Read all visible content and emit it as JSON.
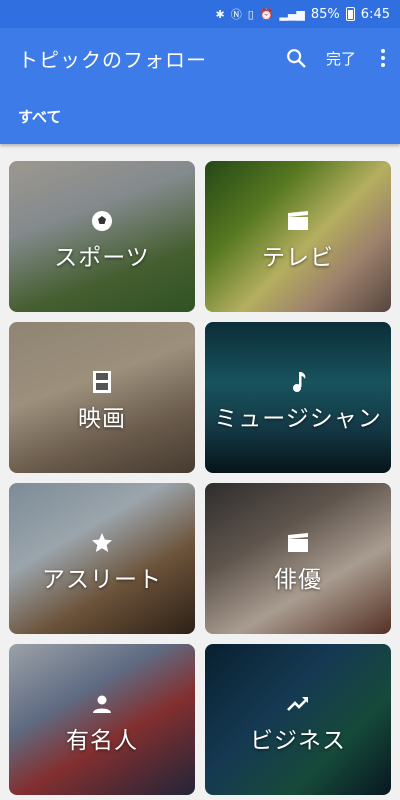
{
  "status_bar": {
    "battery": "85%",
    "time": "6:45",
    "icons": [
      "bluetooth-icon",
      "nfc-icon",
      "vibrate-icon",
      "alarm-icon",
      "signal-icon",
      "battery-icon"
    ]
  },
  "app_bar": {
    "title": "トピックのフォロー",
    "search_icon": "search-icon",
    "done_label": "完了",
    "overflow_icon": "more-vert-icon"
  },
  "tabs": {
    "active_label": "すべて"
  },
  "colors": {
    "primary": "#3d7ce8",
    "status": "#2f6fe0",
    "background": "#f1f1f1"
  },
  "topics": [
    {
      "label": "スポーツ",
      "icon": "soccer-ball-icon"
    },
    {
      "label": "テレビ",
      "icon": "clapperboard-icon"
    },
    {
      "label": "映画",
      "icon": "film-strip-icon"
    },
    {
      "label": "ミュージシャン",
      "icon": "music-note-icon"
    },
    {
      "label": "アスリート",
      "icon": "star-icon"
    },
    {
      "label": "俳優",
      "icon": "clapperboard-icon"
    },
    {
      "label": "有名人",
      "icon": "person-icon"
    },
    {
      "label": "ビジネス",
      "icon": "trending-up-icon"
    }
  ]
}
